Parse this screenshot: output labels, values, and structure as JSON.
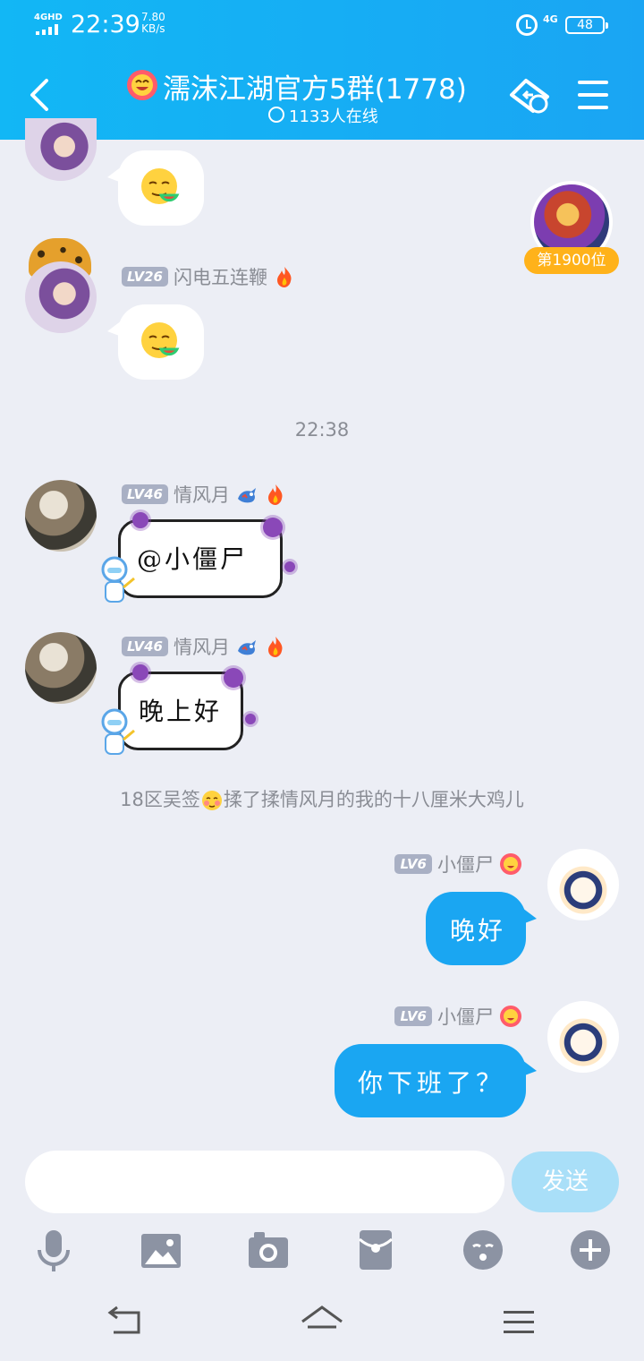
{
  "status_bar": {
    "network": "4GHD",
    "time": "22:39",
    "speed_value": "7.80",
    "speed_unit": "KB/s",
    "net_type": "4G",
    "battery": "48"
  },
  "header": {
    "title": "濡沫江湖官方5群(1778)",
    "online": "1133人在线"
  },
  "rank": {
    "label": "第1900位"
  },
  "messages": [
    {
      "level": "LV26",
      "nick": "闪电五连鞭"
    },
    {
      "time": "22:38"
    },
    {
      "level": "LV46",
      "nick": "情风月",
      "text": "@小僵尸"
    },
    {
      "level": "LV46",
      "nick": "情风月",
      "text": "晚上好"
    },
    {
      "system_prefix": "18区吴签",
      "system_suffix": "揉了揉情风月的我的十八厘米大鸡儿"
    },
    {
      "level": "LV6",
      "nick": "小僵尸",
      "text": "晚好"
    },
    {
      "level": "LV6",
      "nick": "小僵尸",
      "text": "你下班了？"
    }
  ],
  "input": {
    "placeholder": "",
    "send_label": "发送"
  },
  "toolbar": {
    "icons": [
      "microphone-icon",
      "image-icon",
      "camera-icon",
      "red-packet-icon",
      "emoji-icon",
      "plus-icon"
    ]
  },
  "navbar": {
    "icons": [
      "back-nav-icon",
      "home-nav-icon",
      "menu-nav-icon"
    ]
  },
  "colors": {
    "header": "#12b7f5",
    "bubble_self": "#1aa6f2",
    "background": "#eceef5",
    "send_button": "#a9dff8",
    "rank_badge": "#ffb21a"
  }
}
